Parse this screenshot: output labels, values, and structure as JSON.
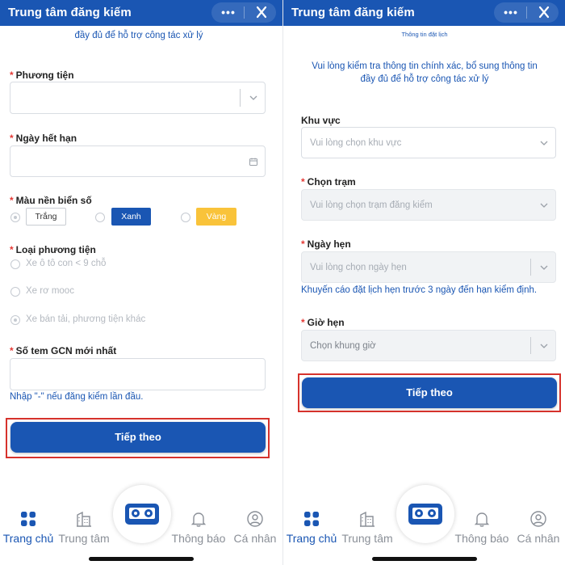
{
  "left_screen": {
    "header": {
      "title": "Trung tâm đăng kiếm",
      "more_label": "•••"
    },
    "notice_partial": "đầy đủ để hỗ trợ công tác xử lý",
    "vehicle": {
      "label": "Phương tiện",
      "required": "*"
    },
    "expiry_date": {
      "label": "Ngày hết hạn",
      "required": "*"
    },
    "plate_color": {
      "label": "Màu nền biển số",
      "required": "*",
      "options": [
        "Trắng",
        "Xanh",
        "Vàng"
      ],
      "colors": {
        "white": "#ffffff",
        "blue": "#1a56b3",
        "yellow": "#f9c33a"
      }
    },
    "vehicle_type": {
      "label": "Loại phương tiện",
      "required": "*",
      "options": [
        "Xe ô tô con < 9 chỗ",
        "Xe rơ mooc",
        "Xe bán tải, phương tiện khác"
      ]
    },
    "gcn_stamp": {
      "label": "Số tem GCN mới nhất",
      "required": "*",
      "hint": "Nhập \"-\" nếu đăng kiểm lần đầu."
    },
    "next_button": "Tiếp theo"
  },
  "right_screen": {
    "header": {
      "title": "Trung tâm đăng kiếm",
      "more_label": "•••"
    },
    "subtitle": "Thông tin đặt lịch",
    "notice_line1": "Vui lòng kiểm tra thông tin chính xác, bổ sung thông tin",
    "notice_line2": "đầy đủ để hỗ trợ công tác xử lý",
    "region": {
      "label": "Khu vực",
      "placeholder": "Vui lòng chọn khu vực"
    },
    "station": {
      "label": "Chọn trạm",
      "required": "*",
      "placeholder": "Vui lòng chọn trạm đăng kiểm"
    },
    "appointment_date": {
      "label": "Ngày hẹn",
      "required": "*",
      "placeholder": "Vui lòng chọn ngày hẹn",
      "hint": "Khuyến cáo đặt lịch hẹn trước 3 ngày đến hạn kiểm định."
    },
    "appointment_time": {
      "label": "Giờ hẹn",
      "required": "*",
      "placeholder": "Chọn khung giờ"
    },
    "next_button": "Tiếp theo"
  },
  "tabbar": {
    "items": [
      "Trang chủ",
      "Trung tâm",
      "Thông báo",
      "Cá nhân"
    ],
    "active_index": 0
  },
  "colors": {
    "primary": "#1a56b3",
    "required": "#e53935",
    "highlight_frame": "#d6322c",
    "inactive_tab": "#8a8f97"
  }
}
